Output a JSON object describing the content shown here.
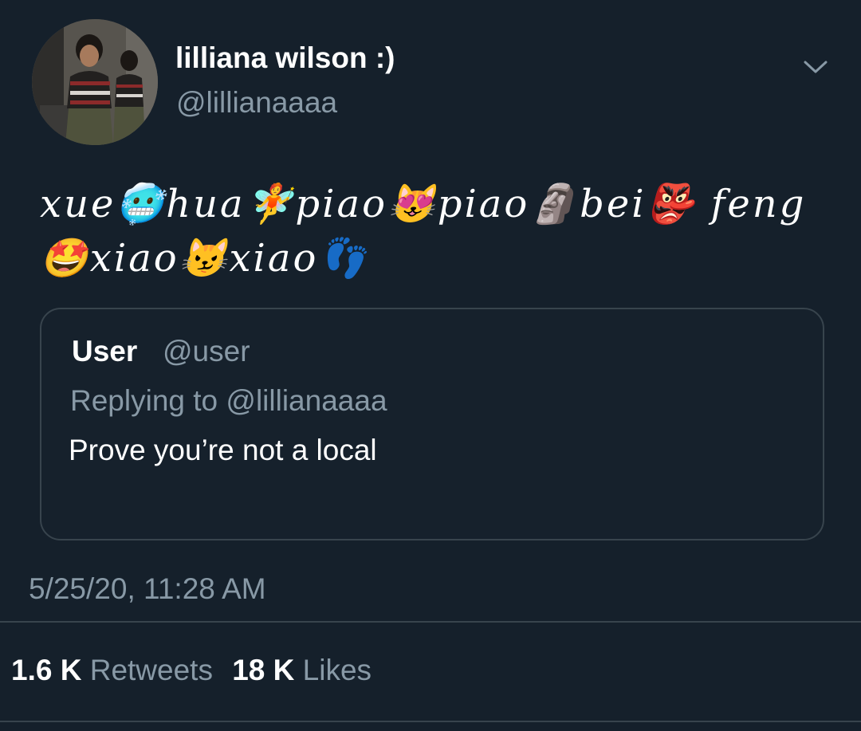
{
  "author": {
    "display_name": "lilliana wilson :)",
    "handle": "@lillianaaaa"
  },
  "tweet": {
    "text": "xue🥶hua🧚piao😻piao🗿bei👺 feng🤩xiao😼xiao👣"
  },
  "quoted_tweet": {
    "name": "User",
    "handle": "@user",
    "replying_to": "Replying to @lillianaaaa",
    "text": "Prove you’re not a local"
  },
  "timestamp": "5/25/20, 11:28 AM",
  "stats": {
    "retweets_count": "1.6 K",
    "retweets_label": "Retweets",
    "likes_count": "18 K",
    "likes_label": "Likes"
  },
  "icons": {
    "menu": "chevron-down-icon"
  },
  "colors": {
    "background": "#15202b",
    "secondary_text": "#8899a6",
    "border": "#38444d"
  }
}
